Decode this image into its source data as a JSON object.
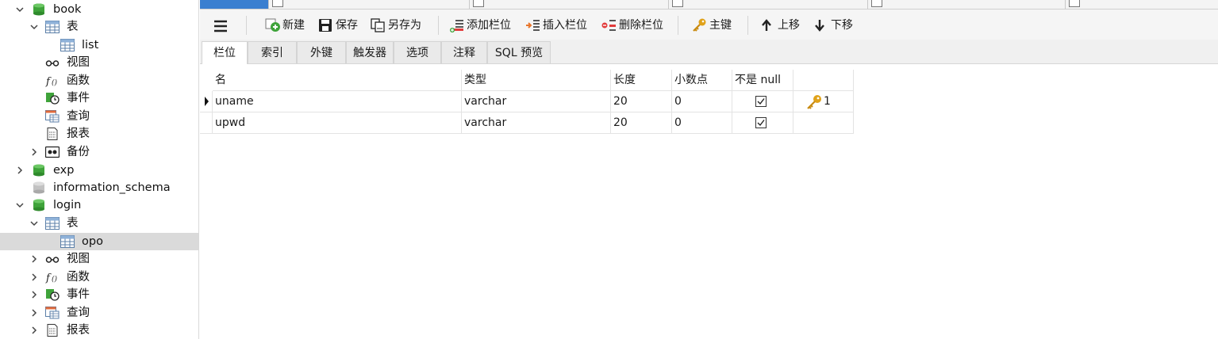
{
  "sidebar": {
    "items": [
      {
        "label": "book"
      },
      {
        "label": "表"
      },
      {
        "label": "list"
      },
      {
        "label": "视图"
      },
      {
        "label": "函数"
      },
      {
        "label": "事件"
      },
      {
        "label": "查询"
      },
      {
        "label": "报表"
      },
      {
        "label": "备份"
      },
      {
        "label": "exp"
      },
      {
        "label": "information_schema"
      },
      {
        "label": "login"
      },
      {
        "label": "表"
      },
      {
        "label": "opo"
      },
      {
        "label": "视图"
      },
      {
        "label": "函数"
      },
      {
        "label": "事件"
      },
      {
        "label": "查询"
      },
      {
        "label": "报表"
      }
    ]
  },
  "toolbar": {
    "menu_icon": "hamburger-icon",
    "new_label": "新建",
    "save_label": "保存",
    "save_as_label": "另存为",
    "add_field_label": "添加栏位",
    "insert_field_label": "插入栏位",
    "delete_field_label": "删除栏位",
    "primary_key_label": "主键",
    "move_up_label": "上移",
    "move_down_label": "下移"
  },
  "subtabs": [
    {
      "label": "栏位"
    },
    {
      "label": "索引"
    },
    {
      "label": "外键"
    },
    {
      "label": "触发器"
    },
    {
      "label": "选项"
    },
    {
      "label": "注释"
    },
    {
      "label": "SQL 预览"
    }
  ],
  "grid": {
    "headers": {
      "name": "名",
      "type": "类型",
      "length": "长度",
      "decimals": "小数点",
      "not_null": "不是 null",
      "key": ""
    },
    "rows": [
      {
        "name": "uname",
        "type": "varchar",
        "length": "20",
        "decimals": "0",
        "not_null": true,
        "key": "1"
      },
      {
        "name": "upwd",
        "type": "varchar",
        "length": "20",
        "decimals": "0",
        "not_null": true,
        "key": ""
      }
    ]
  },
  "colors": {
    "db_green": "#3fa33a",
    "db_grey": "#b5b5b5",
    "selected_row": "#dadada",
    "active_top_tab": "#3a7fd0",
    "key_gold": "#e0a21a"
  }
}
